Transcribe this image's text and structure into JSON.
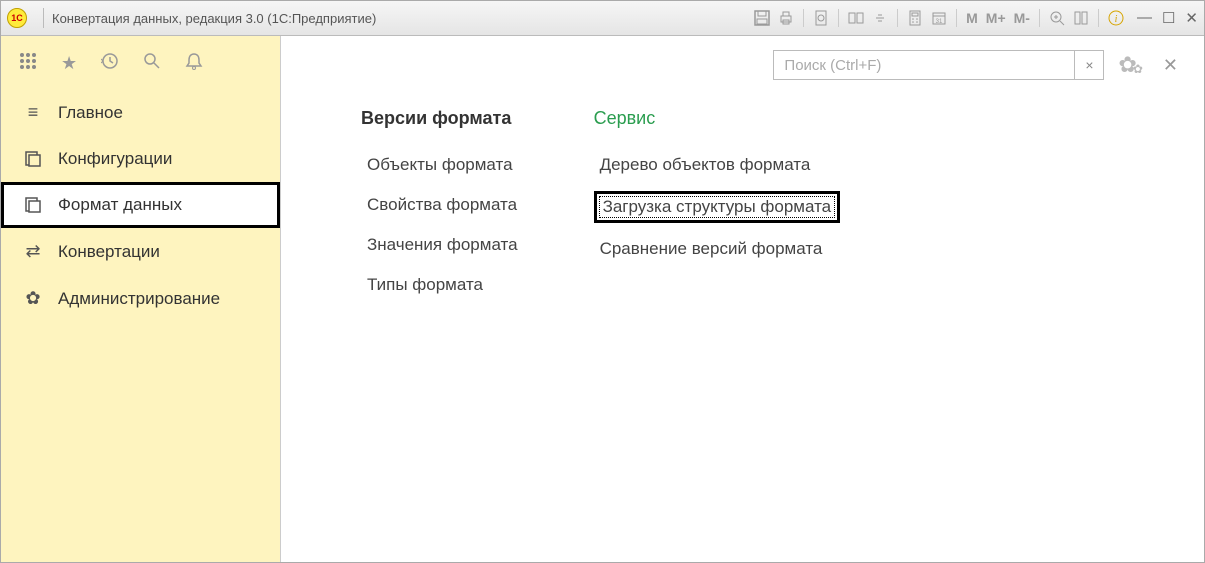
{
  "titlebar": {
    "app_icon_text": "1C",
    "title": "Конвертация данных, редакция 3.0  (1С:Предприятие)",
    "m_labels": [
      "M",
      "M+",
      "M-"
    ]
  },
  "sidebar": {
    "items": [
      {
        "label": "Главное"
      },
      {
        "label": "Конфигурации"
      },
      {
        "label": "Формат данных"
      },
      {
        "label": "Конвертации"
      },
      {
        "label": "Администрирование"
      }
    ]
  },
  "main": {
    "search_placeholder": "Поиск (Ctrl+F)",
    "col1": {
      "title": "Версии формата",
      "links": [
        "Объекты формата",
        "Свойства формата",
        "Значения формата",
        "Типы формата"
      ]
    },
    "col2": {
      "title": "Сервис",
      "links": [
        "Дерево объектов формата",
        "Загрузка структуры формата",
        "Сравнение версий формата"
      ]
    }
  }
}
